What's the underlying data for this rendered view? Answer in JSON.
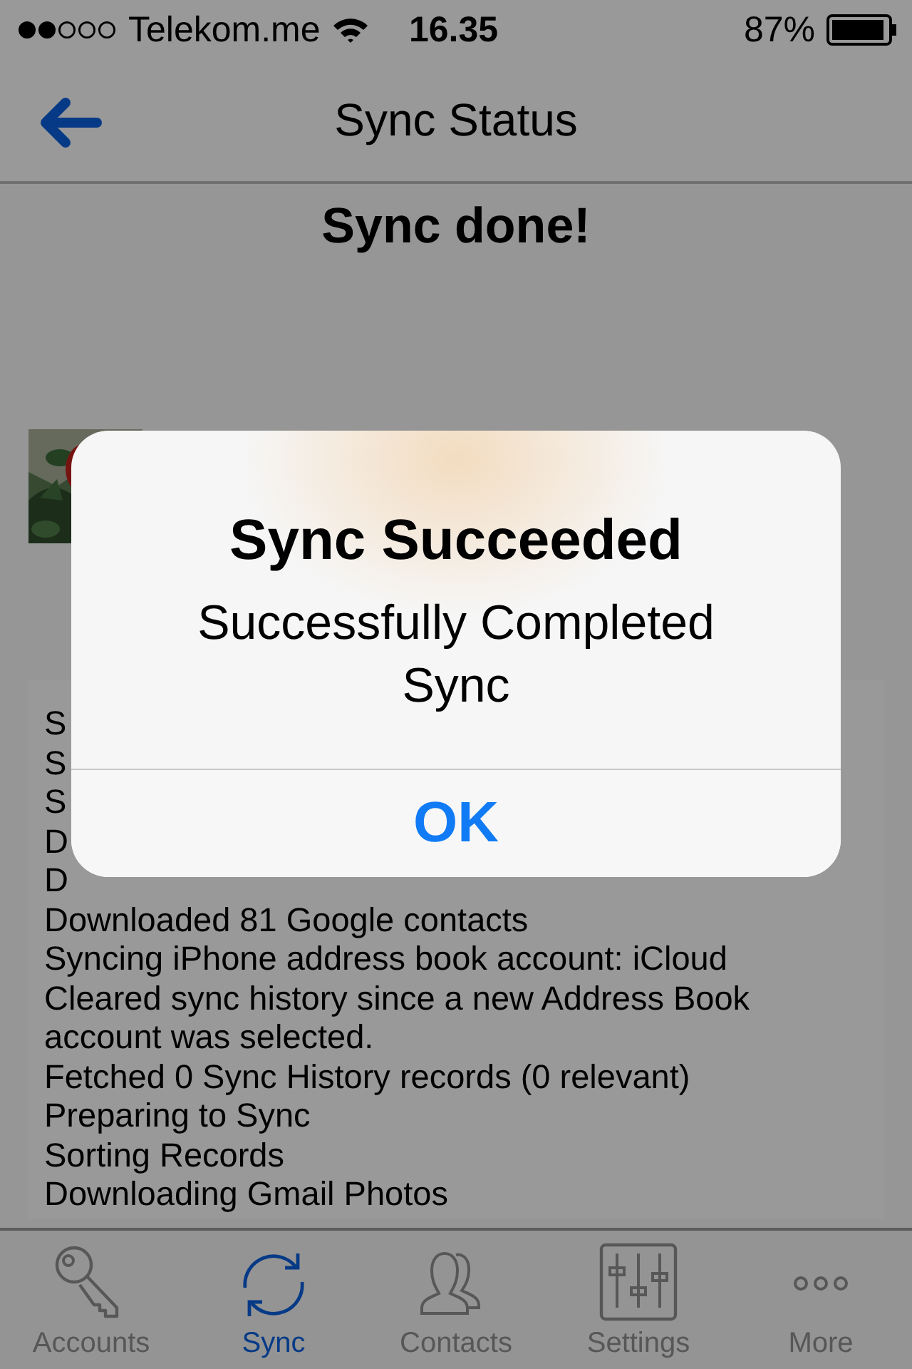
{
  "status_bar": {
    "carrier": "Telekom.me",
    "time": "16.35",
    "battery": "87%"
  },
  "nav_bar": {
    "title": "Sync Status"
  },
  "heading": "Sync done!",
  "log": [
    "S",
    "S",
    "S",
    "D",
    "D",
    "Downloaded 81 Google contacts",
    "Syncing iPhone address book account: iCloud",
    "Cleared sync history since a new Address Book account was selected.",
    "Fetched 0 Sync History records (0 relevant)",
    "Preparing to Sync",
    "Sorting Records",
    "Downloading Gmail Photos"
  ],
  "alert": {
    "title": "Sync Succeeded",
    "message": "Successfully Completed Sync",
    "button": "OK"
  },
  "tab_bar": [
    {
      "label": "Accounts",
      "kind": "key",
      "selected": false
    },
    {
      "label": "Sync",
      "kind": "sync",
      "selected": true
    },
    {
      "label": "Contacts",
      "kind": "people",
      "selected": false
    },
    {
      "label": "Settings",
      "kind": "sliders",
      "selected": false
    },
    {
      "label": "More",
      "kind": "more",
      "selected": false
    }
  ]
}
